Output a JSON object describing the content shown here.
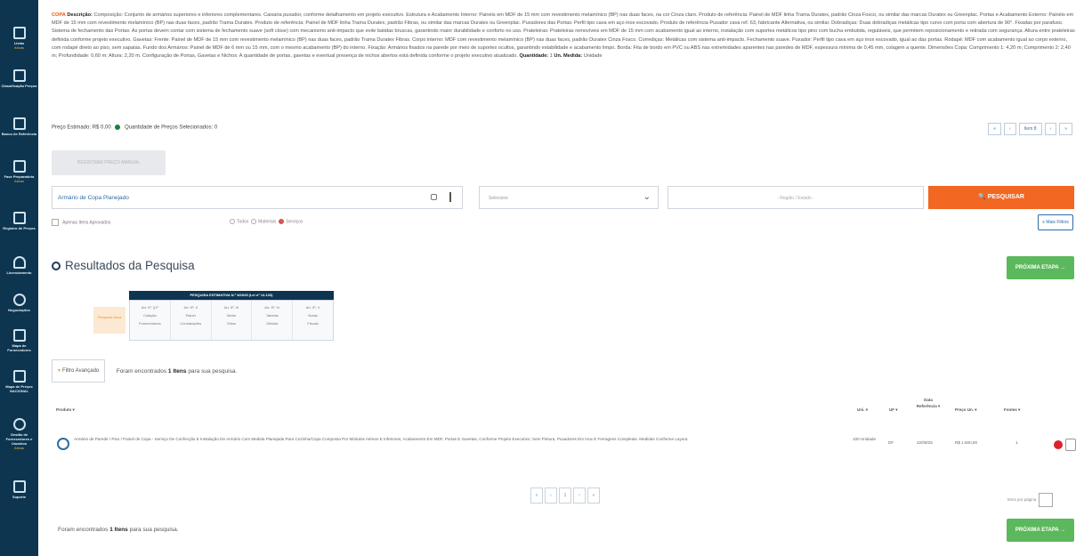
{
  "sidebar": {
    "items": [
      {
        "icon": "copy-icon",
        "label": "Listas",
        "sub": "Ativas"
      },
      {
        "icon": "document-icon",
        "label": "Classificação Preços",
        "sub": ""
      },
      {
        "icon": "calculator-icon",
        "label": "Banco de Referência",
        "sub": ""
      },
      {
        "icon": "folder-icon",
        "label": "Fase Preparatória",
        "sub": "Ativas"
      },
      {
        "icon": "list-icon",
        "label": "Registro de Preços",
        "sub": ""
      },
      {
        "icon": "lock-icon",
        "label": "Licenciamento",
        "sub": ""
      },
      {
        "icon": "handshake-icon",
        "label": "Negociações",
        "sub": ""
      },
      {
        "icon": "box-icon",
        "label": "Mapa de Fornecedores",
        "sub": ""
      },
      {
        "icon": "book-icon",
        "label": "Mapa de Preços NACIONAL",
        "sub": ""
      },
      {
        "icon": "people-icon",
        "label": "Gestão de Fornecedores e Usuários",
        "sub": "Ativas"
      },
      {
        "icon": "exit-icon",
        "label": "Suporte",
        "sub": ""
      }
    ]
  },
  "description": {
    "code": "COPA",
    "label": "Descrição:",
    "text": "Composição: Conjunto de armários superiores e inferiores complementares. Caixaria puxador, conforme detalhamento em projeto executivo. Estrutura e Acabamento Interno: Painéis em MDF de 15 mm com revestimento melamínico (BP) nas duas faces, na cor Cinza claro. Produto de referência: Painel de MDF linha Trama Duratex, padrão Cinza Fosco, ou similar das marcas Duratex ou Greenplac. Portas e Acabamento Externo: Painéis em MDF de 15 mm com revestimento melamínico (BP) nas duas faces, padrão Trama Duratex. Produto de referência: Painel de MDF linha Trama Duratex, padrão Fibras, ou similar das marcas Duratex ou Greenplac. Puxadores das Portas: Perfil tipo cava em aço inox escovado. Produto de referência Puxador cava ref. 63, fabricante Alternativa, ou similar. Dobradiças: Duas dobradiças metálicas tipo curvo com porta com abertura de 90°. Fixadas por parafuso. Sistema de fechamento das Portas: As portas devem contar com sistema de fechamento suave (soft close) com mecanismo anti-impacto que evite batidas bruscas, garantindo maior durabilidade e conforto no uso. Prateleiras: Prateleiras removíveis em MDF de 15 mm com acabamento igual ao interno, instalação com suportes metálicos tipo pino com bucha embutida, reguláveis, que permitem reposicionamento e retirada com segurança. Altura entre prateleiras definida conforme projeto executivo. Gavetas: Frente: Painel de MDF de 15 mm com revestimento melamínico (BP) nas duas faces, padrão Trama Duratex Fibras. Corpo interno: MDF com revestimento melamínico (BP) nas duas faces, padrão Duratex Cinza Fosco. Corrediças: Metálicas com sistema anti-impacto. Fechamento suave. Puxador: Perfil tipo cava em aço inox escovado, igual ao das portas. Rodapé: MDF com acabamento igual ao corpo externo, com rodapé direto ao piso, sem sapatas. Fundo dos Armários: Painel de MDF de 6 mm ou 15 mm, com o mesmo acabamento (BP) do interno. Fixação: Armários fixados na parede por meio de suportes ocultos, garantindo estabilidade e acabamento limpo. Borda: Fita de bordo em PVC ou ABS nas extremidades aparentes nas paredes de MDF, espessura mínima de 0,45 mm, colagem a quente. Dimensões Copa: Comprimento 1: 4,20 m; Comprimento 2: 2,40 m; Profundidade: 0,60 m; Altura: 2,20 m. Configuração de Portas, Gavetas e Nichos: A quantidade de portas, gavetas e eventual presença de nichos abertos está definida conforme o projeto executivo atualizado.",
    "qty_label": "Quantidade:",
    "qty_value": "1",
    "unit_label": "Un. Medida:",
    "unit_value": "Unidade"
  },
  "price_row": {
    "estimated_label": "Preço Estimado:",
    "estimated_value": "R$ 0,00",
    "selected_label": "Quantidade de Preços Selecionados:",
    "selected_value": "0"
  },
  "top_pager": {
    "first": "«",
    "prev": "‹",
    "item": "Item 8",
    "next": "›",
    "last": "»"
  },
  "disabled_button": "REGISTRAR PREÇO MANUAL",
  "search": {
    "query": "Armário de Copa Planejado",
    "select_placeholder": "Selecione",
    "location_placeholder": "- Região / Estado -",
    "search_button": "🔍 PESQUISAR"
  },
  "filters": {
    "checkbox_label": "Apenas Itens Aprovados",
    "radio1": "Todos",
    "radio2": "Materiais",
    "radio3": "Serviços",
    "more_filters": "≡ Mais Filtros"
  },
  "results": {
    "title": "Resultados da Pesquisa",
    "next_step": "PRÓXIMA ETAPA →"
  },
  "stats": {
    "header": "PESQUISA ESTIMATIVA N.º 8/2025 (Lei nº 14.133)",
    "left_label": "Pesquisa Ativa",
    "columns": [
      {
        "l1": "Art. 5º, §1º",
        "l2": "Cotação",
        "l3": "Fornecedores"
      },
      {
        "l1": "Art. 5º, II",
        "l2": "Painel",
        "l3": "Contratações"
      },
      {
        "l1": "Art. 5º, III",
        "l2": "Mídia",
        "l3": "Sítios"
      },
      {
        "l1": "Art. 5º, IV",
        "l2": "Tabelas",
        "l3": "Oficiais"
      },
      {
        "l1": "Art. 5º, V",
        "l2": "Notas",
        "l3": "Fiscais"
      }
    ]
  },
  "advanced_filter": {
    "button": "Filtro Avançado",
    "found_prefix": "Foram encontrados",
    "found_count": "1 Itens",
    "found_suffix": "para sua pesquisa."
  },
  "table": {
    "headers": [
      "Produto ▾",
      "Uni. ▾",
      "UF ▾",
      "Data Referência ▾",
      "Preço Un. ▾",
      "Fontes ▾"
    ],
    "row": {
      "product": "Armário de Parede / Piso / Painel de Copa - Serviço De Confecção E Instalação De Armário Com Medida Planejada Para Cozinha/Copa Composta Por Módulos Aéreos E Inferiores, Acabamento Em MDF, Portas E Gavetas, Conforme Projeto Executivo; Sem Pintura, Puxadores Em Inox E Ferragens Completas. Medidas Conforme Layout.",
      "unit": "100 Unidade",
      "uf": "DF",
      "date": "22/08/25",
      "price": "R$ 1.500,00",
      "sources": "1"
    }
  },
  "bottom_pager": {
    "first": "«",
    "prev": "‹",
    "page": "1",
    "next": "›",
    "last": "»"
  },
  "per_page_label": "Itens por página",
  "bottom_found": {
    "prefix": "Foram encontrados",
    "count": "1 Itens",
    "suffix": "para sua pesquisa."
  },
  "colors": {
    "sidebar": "#0d3550",
    "search_button": "#f26722",
    "next_button": "#5cb85c"
  }
}
